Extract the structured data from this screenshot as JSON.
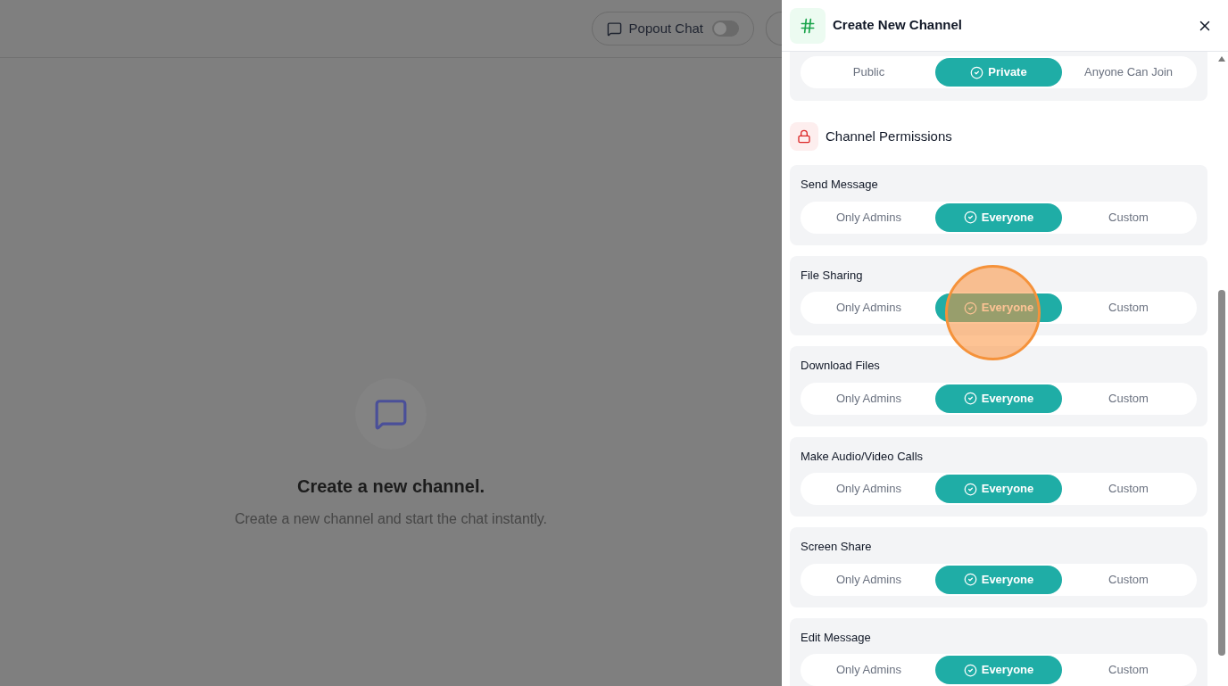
{
  "topbar": {
    "popout": {
      "label": "Popout Chat",
      "on": false
    }
  },
  "empty_state": {
    "title": "Create a new channel.",
    "subtitle": "Create a new channel and start the chat instantly."
  },
  "drawer": {
    "title": "Create New Channel",
    "visibility": [
      {
        "label": "Public",
        "selected": false
      },
      {
        "label": "Private",
        "selected": true
      },
      {
        "label": "Anyone Can Join",
        "selected": false
      }
    ],
    "permissions_title": "Channel Permissions",
    "permissions": [
      {
        "label": "Send Message",
        "options": [
          {
            "label": "Only Admins",
            "selected": false
          },
          {
            "label": "Everyone",
            "selected": true
          },
          {
            "label": "Custom",
            "selected": false
          }
        ]
      },
      {
        "label": "File Sharing",
        "options": [
          {
            "label": "Only Admins",
            "selected": false
          },
          {
            "label": "Everyone",
            "selected": true
          },
          {
            "label": "Custom",
            "selected": false
          }
        ]
      },
      {
        "label": "Download Files",
        "options": [
          {
            "label": "Only Admins",
            "selected": false
          },
          {
            "label": "Everyone",
            "selected": true
          },
          {
            "label": "Custom",
            "selected": false
          }
        ]
      },
      {
        "label": "Make Audio/Video Calls",
        "options": [
          {
            "label": "Only Admins",
            "selected": false
          },
          {
            "label": "Everyone",
            "selected": true
          },
          {
            "label": "Custom",
            "selected": false
          }
        ]
      },
      {
        "label": "Screen Share",
        "options": [
          {
            "label": "Only Admins",
            "selected": false
          },
          {
            "label": "Everyone",
            "selected": true
          },
          {
            "label": "Custom",
            "selected": false
          }
        ]
      },
      {
        "label": "Edit Message",
        "options": [
          {
            "label": "Only Admins",
            "selected": false
          },
          {
            "label": "Everyone",
            "selected": true
          },
          {
            "label": "Custom",
            "selected": false
          }
        ]
      }
    ]
  }
}
